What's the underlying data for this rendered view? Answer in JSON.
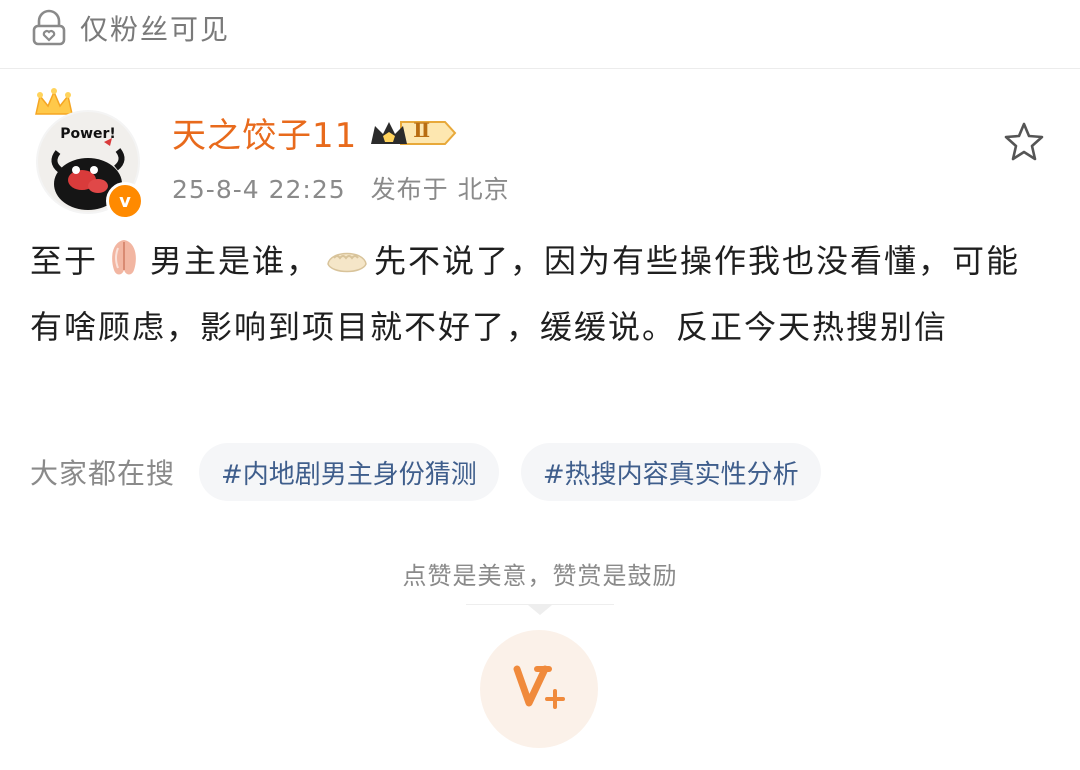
{
  "topbar": {
    "visibility_icon": "lock-heart-icon",
    "visibility_text": "仅粉丝可见"
  },
  "post": {
    "author": {
      "avatar_text": "Power!",
      "name": "天之饺子11",
      "level_badge": "Ⅱ",
      "verified_mark": "v"
    },
    "meta": {
      "datetime": "25-8-4 22:25",
      "location": "发布于 北京"
    },
    "content": {
      "segment_1": "至于",
      "segment_2": "男主是谁，",
      "segment_3": "先不说了，因为有些操作我也没看懂，可能有啥顾虑，影响到项目就不好了，缓缓说。反正今天热搜别信"
    }
  },
  "search": {
    "label": "大家都在搜",
    "chips": [
      "#内地剧男主身份猜测",
      "#热搜内容真实性分析"
    ]
  },
  "reward": {
    "text": "点赞是美意，赞赏是鼓励",
    "icon": "reward-v-plus-icon"
  },
  "colors": {
    "username": "#e86a1c",
    "chip_text": "#3f5e8c",
    "reward_bg": "#fbf1e9",
    "reward_icon": "#f08a3c"
  }
}
